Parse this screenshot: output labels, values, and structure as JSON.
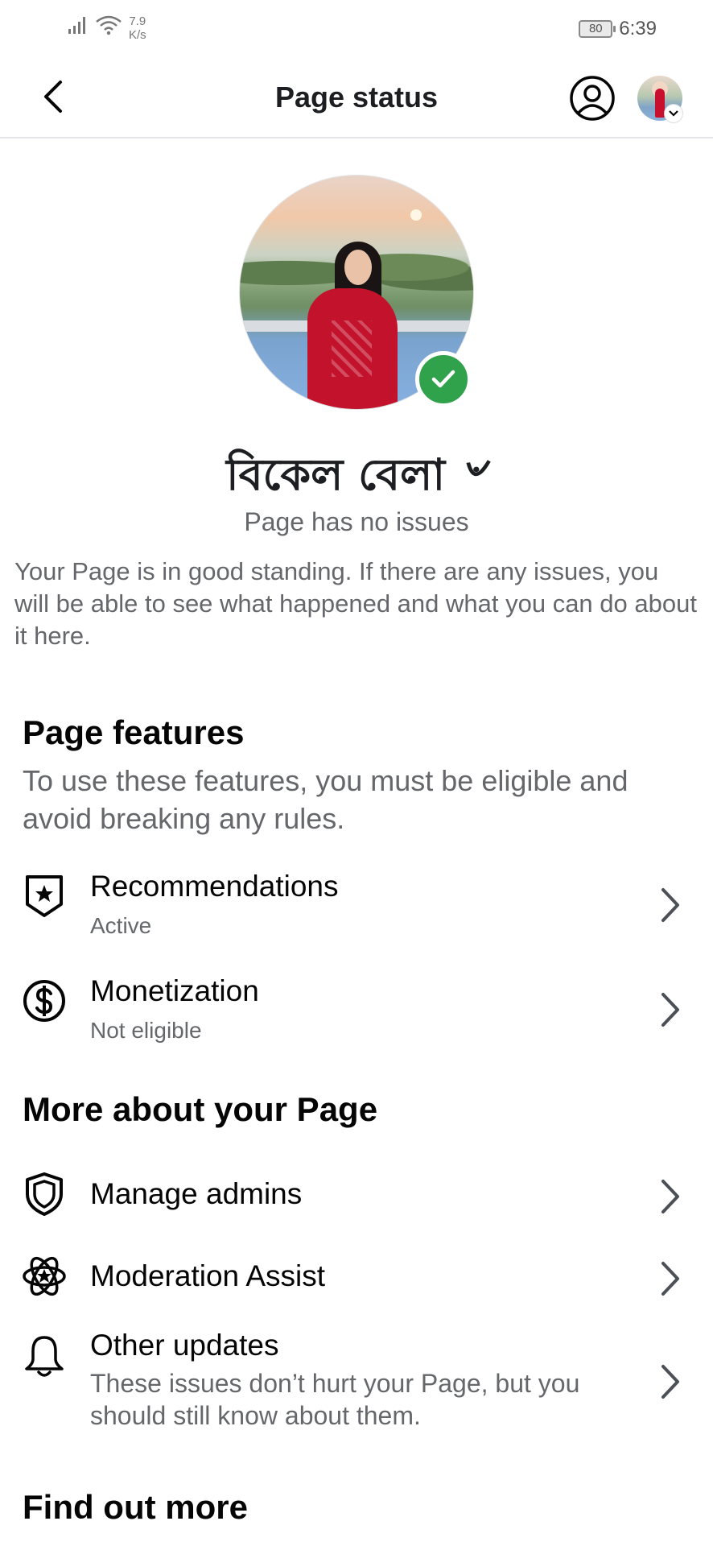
{
  "status_bar": {
    "speed_value": "7.9",
    "speed_unit": "K/s",
    "battery": "80",
    "time": "6:39"
  },
  "header": {
    "title": "Page status"
  },
  "page": {
    "name": "বিকেল বেলা ৺",
    "status": "Page has no issues",
    "description": "Your Page is in good standing. If there are any issues, you will be able to see what happened and what you can do about it here."
  },
  "features": {
    "title": "Page features",
    "subtitle": "To use these features, you must be eligible and avoid breaking any rules.",
    "items": [
      {
        "label": "Recommendations",
        "status": "Active",
        "icon": "shield-star-icon"
      },
      {
        "label": "Monetization",
        "status": "Not eligible",
        "icon": "dollar-circle-icon"
      }
    ]
  },
  "more": {
    "title": "More about your Page",
    "items": [
      {
        "label": "Manage admins",
        "icon": "shield-icon"
      },
      {
        "label": "Moderation Assist",
        "icon": "moderation-gear-icon"
      },
      {
        "label": "Other updates",
        "description": "These issues don’t hurt your Page, but you should still know about them.",
        "icon": "bell-icon"
      }
    ]
  },
  "find_out_more": {
    "title": "Find out more"
  },
  "colors": {
    "verified_green": "#31a24c",
    "text_primary": "#050505",
    "text_secondary": "#65676b"
  }
}
